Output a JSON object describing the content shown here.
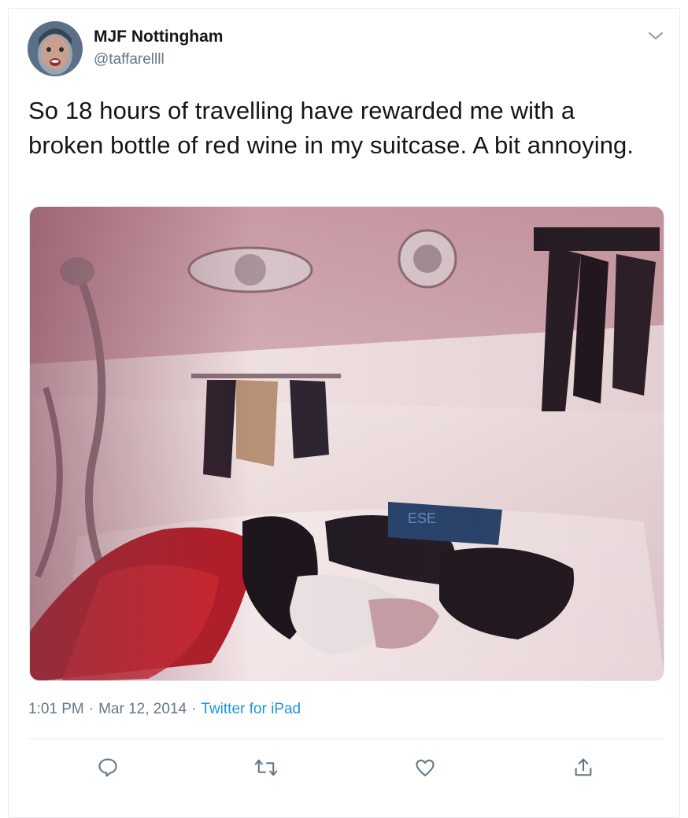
{
  "tweet": {
    "author": {
      "display_name": "MJF Nottingham",
      "handle": "@taffarellll"
    },
    "text": "So 18 hours of travelling have rewarded me with a broken bottle of red wine in my suitcase. A bit annoying.",
    "time": "1:01 PM",
    "separator": "·",
    "date": "Mar 12, 2014",
    "source": "Twitter for iPad"
  },
  "icons": {
    "menu": "chevron-down-icon",
    "reply": "reply-icon",
    "retweet": "retweet-icon",
    "like": "heart-icon",
    "share": "share-icon"
  },
  "colors": {
    "text": "#14171a",
    "secondary": "#657786",
    "link": "#1b95e0",
    "border": "#e6ecf0"
  }
}
